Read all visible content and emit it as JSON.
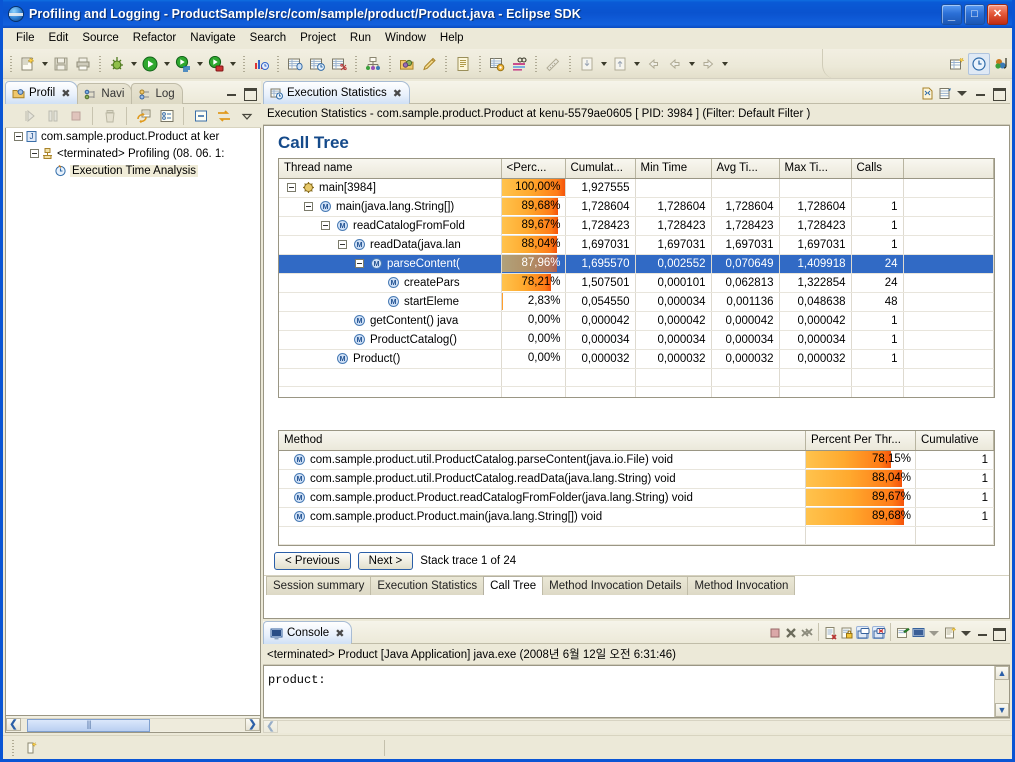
{
  "window": {
    "title": "Profiling and Logging - ProductSample/src/com/sample/product/Product.java - Eclipse SDK",
    "minimize_label": "_",
    "maximize_label": "□",
    "close_label": "✕",
    "app_icon": "eclipse-icon"
  },
  "menubar": {
    "items": [
      {
        "label": "File"
      },
      {
        "label": "Edit"
      },
      {
        "label": "Source"
      },
      {
        "label": "Refactor"
      },
      {
        "label": "Navigate"
      },
      {
        "label": "Search"
      },
      {
        "label": "Project"
      },
      {
        "label": "Run"
      },
      {
        "label": "Window"
      },
      {
        "label": "Help"
      }
    ]
  },
  "toolbar": {
    "icons": [
      "new-wizard-icon",
      "save-icon",
      "print-icon",
      "debug-icon",
      "run-icon",
      "profile-icon",
      "run-coverage-icon",
      "open-profiling-icon",
      "memory-statistics-icon",
      "execution-statistics-icon",
      "coverage-statistics-icon",
      "thread-analysis-icon",
      "open-type-icon",
      "search-icon",
      "new-java-file-icon",
      "build-icon",
      "glasses-icon",
      "ruler-icon",
      "import-icon",
      "export-icon",
      "back-icon",
      "back-history-icon",
      "forward-history-icon",
      "new-table-icon",
      "profiling-perspective-icon",
      "java-perspective-icon"
    ]
  },
  "left_view": {
    "tabs": [
      {
        "label": "Profil",
        "icon": "profiling-monitor-icon",
        "active": true,
        "closable": true
      },
      {
        "label": "Navi",
        "icon": "navigator-icon",
        "active": false,
        "closable": false
      },
      {
        "label": "Log",
        "icon": "log-icon",
        "active": false,
        "closable": false
      }
    ],
    "toolbar_icons": [
      "resume-icon",
      "pause-icon",
      "terminate-icon",
      "delete-icon",
      "refresh-views-icon",
      "show-details-icon",
      "collapse-all-icon",
      "sync-icon",
      "view-menu-icon"
    ],
    "tree": [
      {
        "label": "com.sample.product.Product at ker",
        "icon": "java-launch-icon",
        "depth": 0,
        "expanded": true
      },
      {
        "label": "<terminated> Profiling (08. 06. 1:",
        "icon": "process-icon",
        "depth": 1,
        "expanded": true
      },
      {
        "label": "Execution Time Analysis",
        "icon": "execution-time-analysis-icon",
        "depth": 2,
        "selected": true
      }
    ]
  },
  "editor": {
    "tab": {
      "label": "Execution Statistics",
      "icon": "execution-statistics-icon",
      "closable": true
    },
    "tab_buttons": [
      "restore-icon",
      "view-menu-icon",
      "minimize-icon",
      "maximize-icon"
    ],
    "header_line": "Execution Statistics - com.sample.product.Product at kenu-5579ae0605 [ PID: 3984 ]  (Filter: Default Filter )",
    "section_title": "Call Tree",
    "call_tree": {
      "columns": [
        "Thread name",
        "<Perc...",
        "Cumulat...",
        "Min Time",
        "Avg Ti...",
        "Max Ti...",
        "Calls",
        ""
      ],
      "rows": [
        {
          "name": "main[3984]",
          "icon": "thread-icon",
          "depth": 0,
          "expanded": true,
          "percent": "100,00%",
          "percent_value": 100.0,
          "cumulative": "1,927555",
          "min": "",
          "avg": "",
          "max": "",
          "calls": "",
          "selected": false
        },
        {
          "name": "main(java.lang.String[])",
          "icon": "method-icon",
          "depth": 1,
          "expanded": true,
          "percent": "89,68%",
          "percent_value": 89.68,
          "cumulative": "1,728604",
          "min": "1,728604",
          "avg": "1,728604",
          "max": "1,728604",
          "calls": "1",
          "selected": false
        },
        {
          "name": "readCatalogFromFold",
          "icon": "method-icon",
          "depth": 2,
          "expanded": true,
          "percent": "89,67%",
          "percent_value": 89.67,
          "cumulative": "1,728423",
          "min": "1,728423",
          "avg": "1,728423",
          "max": "1,728423",
          "calls": "1",
          "selected": false
        },
        {
          "name": "readData(java.lan",
          "icon": "method-icon",
          "depth": 3,
          "expanded": true,
          "percent": "88,04%",
          "percent_value": 88.04,
          "cumulative": "1,697031",
          "min": "1,697031",
          "avg": "1,697031",
          "max": "1,697031",
          "calls": "1",
          "selected": false
        },
        {
          "name": "parseContent(",
          "icon": "method-icon",
          "depth": 4,
          "expanded": true,
          "percent": "87,96%",
          "percent_value": 87.96,
          "cumulative": "1,695570",
          "min": "0,002552",
          "avg": "0,070649",
          "max": "1,409918",
          "calls": "24",
          "selected": true
        },
        {
          "name": "createPars",
          "icon": "method-icon",
          "depth": 5,
          "expanded": false,
          "percent": "78,21%",
          "percent_value": 78.21,
          "cumulative": "1,507501",
          "min": "0,000101",
          "avg": "0,062813",
          "max": "1,322854",
          "calls": "24",
          "selected": false
        },
        {
          "name": "startEleme",
          "icon": "method-icon",
          "depth": 5,
          "expanded": false,
          "percent": "2,83%",
          "percent_value": 2.83,
          "cumulative": "0,054550",
          "min": "0,000034",
          "avg": "0,001136",
          "max": "0,048638",
          "calls": "48",
          "selected": false
        },
        {
          "name": "getContent() java",
          "icon": "method-icon",
          "depth": 3,
          "expanded": false,
          "percent": "0,00%",
          "percent_value": 0.0,
          "cumulative": "0,000042",
          "min": "0,000042",
          "avg": "0,000042",
          "max": "0,000042",
          "calls": "1",
          "selected": false
        },
        {
          "name": "ProductCatalog()",
          "icon": "method-icon",
          "depth": 3,
          "expanded": false,
          "percent": "0,00%",
          "percent_value": 0.0,
          "cumulative": "0,000034",
          "min": "0,000034",
          "avg": "0,000034",
          "max": "0,000034",
          "calls": "1",
          "selected": false
        },
        {
          "name": "Product()",
          "icon": "method-icon",
          "depth": 2,
          "expanded": false,
          "percent": "0,00%",
          "percent_value": 0.0,
          "cumulative": "0,000032",
          "min": "0,000032",
          "avg": "0,000032",
          "max": "0,000032",
          "calls": "1",
          "selected": false
        }
      ]
    },
    "method_table": {
      "columns": [
        "Method",
        "Percent Per Thr...",
        "Cumulative"
      ],
      "rows": [
        {
          "method": "com.sample.product.util.ProductCatalog.parseContent(java.io.File) void",
          "icon": "method-icon",
          "percent": "78,15%",
          "percent_value": 78.15,
          "cumulative": "1"
        },
        {
          "method": "com.sample.product.util.ProductCatalog.readData(java.lang.String) void",
          "icon": "method-icon",
          "percent": "88,04%",
          "percent_value": 88.04,
          "cumulative": "1"
        },
        {
          "method": "com.sample.product.Product.readCatalogFromFolder(java.lang.String) void",
          "icon": "method-icon",
          "percent": "89,67%",
          "percent_value": 89.67,
          "cumulative": "1"
        },
        {
          "method": "com.sample.product.Product.main(java.lang.String[]) void",
          "icon": "method-icon",
          "percent": "89,68%",
          "percent_value": 89.68,
          "cumulative": "1"
        }
      ]
    },
    "navigation": {
      "previous_label": "< Previous",
      "next_label": "Next >",
      "stack_trace_text": "Stack trace 1 of 24"
    },
    "bottom_tabs": [
      {
        "label": "Session summary",
        "active": false
      },
      {
        "label": "Execution Statistics",
        "active": false
      },
      {
        "label": "Call Tree",
        "active": true
      },
      {
        "label": "Method Invocation Details",
        "active": false
      },
      {
        "label": "Method Invocation",
        "active": false
      }
    ]
  },
  "console": {
    "tab": {
      "label": "Console",
      "icon": "console-icon",
      "closable": true
    },
    "header_line": "<terminated> Product [Java Application] java.exe (2008년 6월 12일 오전 6:31:46)",
    "output": "product:",
    "toolbar_icons": [
      "terminate-icon",
      "remove-launch-icon",
      "remove-all-launches-icon",
      "clear-console-icon",
      "scroll-lock-icon",
      "show-console-icon",
      "show-console-on-error-icon",
      "pin-console-icon",
      "display-selected-console-icon",
      "open-console-icon",
      "minimize-icon",
      "maximize-icon"
    ]
  },
  "statusbar": {
    "icon": "writable-indicator-icon",
    "text": ""
  },
  "colors": {
    "title_blue": "#0a55d4",
    "selection_blue": "#316ac5",
    "bar_orange_start": "#ffc34d",
    "bar_orange_end": "#f4530a",
    "chrome": "#ece9d8",
    "heading_blue": "#154a8a"
  }
}
